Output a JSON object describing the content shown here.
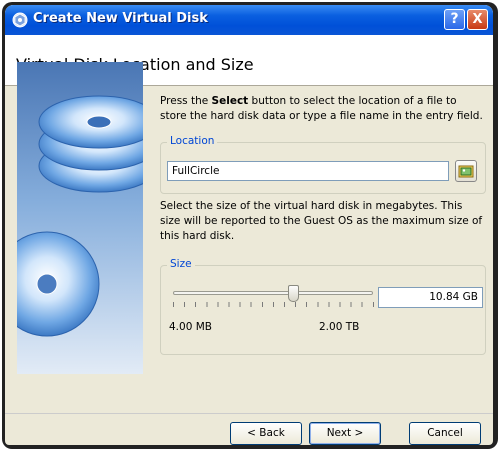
{
  "window": {
    "title": "Create New Virtual Disk",
    "help_label": "?",
    "close_label": "X"
  },
  "header": {
    "title": "Virtual Disk Location and Size"
  },
  "location": {
    "description_prefix": "Press the ",
    "description_bold": "Select",
    "description_suffix": " button to select the location of a file to store the hard disk data or type a file name in the entry field.",
    "group_label": "Location",
    "value": "FullCircle",
    "select_icon": "folder-image-icon"
  },
  "size": {
    "description": "Select the size of the virtual hard disk in megabytes. This size will be reported to the Guest OS as the maximum size of this hard disk.",
    "group_label": "Size",
    "value": "10.84 GB",
    "min_label": "4.00 MB",
    "max_label": "2.00 TB",
    "slider_position_fraction": 0.6
  },
  "buttons": {
    "back": "< Back",
    "next": "Next >",
    "cancel": "Cancel"
  },
  "colors": {
    "titlebar": "#0a5fe0",
    "legend": "#0046d5",
    "window_bg": "#ece9d8"
  }
}
